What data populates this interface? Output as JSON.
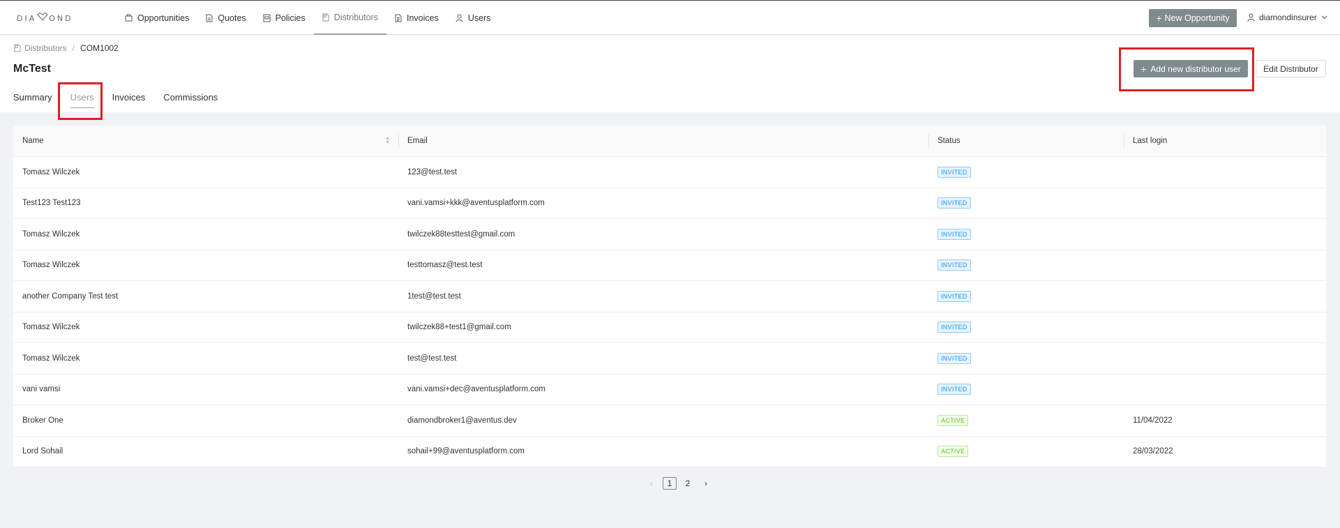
{
  "brand": {
    "logo_left": "DIA",
    "logo_right": "OND"
  },
  "nav": {
    "items": [
      {
        "label": "Opportunities",
        "icon": "briefcase-icon"
      },
      {
        "label": "Quotes",
        "icon": "document-icon"
      },
      {
        "label": "Policies",
        "icon": "policy-icon"
      },
      {
        "label": "Distributors",
        "icon": "distributor-icon",
        "active": true
      },
      {
        "label": "Invoices",
        "icon": "invoice-icon"
      },
      {
        "label": "Users",
        "icon": "user-icon"
      }
    ],
    "new_opportunity_label": "New Opportunity",
    "user_name": "diamondinsurer"
  },
  "breadcrumb": {
    "root": "Distributors",
    "current": "COM1002"
  },
  "page": {
    "title": "McTest",
    "add_user_label": "Add new distributor user",
    "edit_label": "Edit Distributor"
  },
  "tabs": [
    {
      "label": "Summary"
    },
    {
      "label": "Users",
      "active": true
    },
    {
      "label": "Invoices"
    },
    {
      "label": "Commissions"
    }
  ],
  "table": {
    "columns": [
      "Name",
      "Email",
      "Status",
      "Last login"
    ],
    "rows": [
      {
        "name": "Tomasz Wilczek",
        "email": "123@test.test",
        "status": "INVITED",
        "last_login": ""
      },
      {
        "name": "Test123 Test123",
        "email": "vani.vamsi+kkk@aventusplatform.com",
        "status": "INVITED",
        "last_login": ""
      },
      {
        "name": "Tomasz Wilczek",
        "email": "twilczek88testtest@gmail.com",
        "status": "INVITED",
        "last_login": ""
      },
      {
        "name": "Tomasz Wilczek",
        "email": "testtomasz@test.test",
        "status": "INVITED",
        "last_login": ""
      },
      {
        "name": "another Company Test test",
        "email": "1test@test.test",
        "status": "INVITED",
        "last_login": ""
      },
      {
        "name": "Tomasz Wilczek",
        "email": "twilczek88+test1@gmail.com",
        "status": "INVITED",
        "last_login": ""
      },
      {
        "name": "Tomasz Wilczek",
        "email": "test@test.test",
        "status": "INVITED",
        "last_login": ""
      },
      {
        "name": "vani vamsi",
        "email": "vani.vamsi+dec@aventusplatform.com",
        "status": "INVITED",
        "last_login": ""
      },
      {
        "name": "Broker One",
        "email": "diamondbroker1@aventus.dev",
        "status": "ACTIVE",
        "last_login": "11/04/2022"
      },
      {
        "name": "Lord Sohail",
        "email": "sohail+99@aventusplatform.com",
        "status": "ACTIVE",
        "last_login": "28/03/2022"
      }
    ]
  },
  "pagination": {
    "prev": "‹",
    "pages": [
      "1",
      "2"
    ],
    "current": "1",
    "next": "›"
  },
  "colors": {
    "primary_button": "#808b8e",
    "highlight": "#e01f26",
    "invited": "#1890ff",
    "active": "#52c41a"
  }
}
